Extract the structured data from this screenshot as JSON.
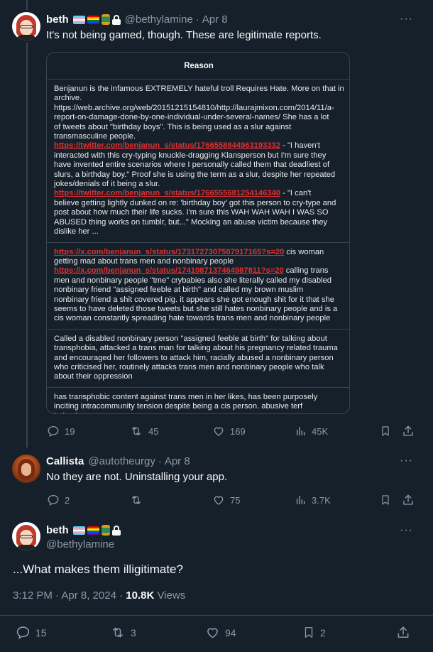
{
  "tweets": [
    {
      "name": "beth",
      "handle": "@bethylamine",
      "sep": "·",
      "date": "Apr 8",
      "text": "It's not being gamed, though. These are legitimate reports.",
      "card": {
        "header": "Reason",
        "cells": [
          [
            {
              "t": "Benjanun is the infamous EXTREMELY hateful troll Requires Hate. More on that in"
            },
            {
              "t": "archive."
            },
            {
              "t": "https://web.archive.org/web/20151215154810/http://laurajmixon.com/2014/11/a-"
            },
            {
              "t": "report-on-damage-done-by-one-individual-under-several-names/ She has a lot"
            },
            {
              "t": "of tweets about \"birthday boys\". This is being used as a slur against"
            },
            {
              "t": "transmasculine people."
            },
            {
              "l": "https://twitter.com/benjanun_s/status/1766558844963193332",
              "t": " - \"I haven't"
            },
            {
              "t": "interacted with this cry-typing knuckle-dragging Klansperson but I'm sure they"
            },
            {
              "t": "have invented entire scenarios where I personally called them that deadliest of"
            },
            {
              "t": "slurs, a birthday boy.\" Proof she is using the term as a slur, despite her repeated"
            },
            {
              "t": "jokes/denials of it being a slur."
            },
            {
              "l": "https://twitter.com/benjanun_s/status/1766555681254146340",
              "t": " - \"I can't"
            },
            {
              "t": "believe getting lightly dunked on re: 'birthday boy' got this person to cry-type and"
            },
            {
              "t": "post about how much their life sucks. I'm sure this WAH WAH WAH I WAS SO"
            },
            {
              "t": "ABUSED thing works on tumblr, but...\" Mocking an abuse victim because they"
            },
            {
              "t": "dislike her ..."
            }
          ],
          [
            {
              "l": "https://x.com/benjanun_s/status/1731727307507917165?s=20",
              "t": " cis woman"
            },
            {
              "t": "getting mad about trans men and nonbinary people"
            },
            {
              "l": "https://x.com/benjanun_s/status/1741087137464987811?s=20",
              "t": " calling trans"
            },
            {
              "t": "men and nonbinary people \"tme\" crybabies also she literally called my disabled"
            },
            {
              "t": "nonbinary friend \"assigned feeble at birth\" and called my brown muslim"
            },
            {
              "t": "nonbinary friend a shit covered pig. it appears she got enough shit for it that she"
            },
            {
              "t": "seems to have deleted those tweets but she still hates nonbinary people and is a"
            },
            {
              "t": "cis woman constantly spreading hate towards trans men and nonbinary people"
            }
          ],
          [
            {
              "t": "Called a disabled nonbinary person \"assigned feeble at birth\" for talking about"
            },
            {
              "t": "transphobia, attacked a trans man for talking about his pregnancy related trauma"
            },
            {
              "t": "and encouraged her followers to attack him, racially abused a nonbinary person"
            },
            {
              "t": "who criticised her, routinely attacks trans men and nonbinary people who talk"
            },
            {
              "t": "about their oppression"
            }
          ],
          [
            {
              "t": "has transphobic content against trans men in her likes, has been purposely"
            },
            {
              "t": "inciting intracommunity tension despite being a cis person. abusive terf"
            },
            {
              "t": "behaviour."
            }
          ]
        ]
      },
      "stats": {
        "replies": "19",
        "reposts": "45",
        "likes": "169",
        "views": "45K"
      }
    },
    {
      "name": "Callista",
      "handle": "@autotheurgy",
      "sep": "·",
      "date": "Apr 8",
      "text": "No they are not. Uninstalling your app.",
      "stats": {
        "replies": "2",
        "reposts": "",
        "likes": "75",
        "views": "3.7K"
      }
    },
    {
      "name": "beth",
      "handle": "@bethylamine",
      "text": "...What makes them illigitimate?",
      "time": "3:12 PM · Apr 8, 2024 · ",
      "views_count": "10.8K",
      "views_label": " Views",
      "stats": {
        "replies": "15",
        "reposts": "3",
        "likes": "94",
        "bookmarks": "2"
      }
    }
  ],
  "more_glyph": "···",
  "icons": [
    "reply-icon",
    "repost-icon",
    "like-icon",
    "views-icon",
    "bookmark-icon",
    "share-icon",
    "more-icon",
    "lock-icon",
    "trans-flag-icon",
    "rainbow-flag-icon",
    "can-icon"
  ],
  "colors": {
    "background": "#15202b",
    "border": "#38444d",
    "muted": "#8b98a5",
    "link": "#e03030"
  }
}
